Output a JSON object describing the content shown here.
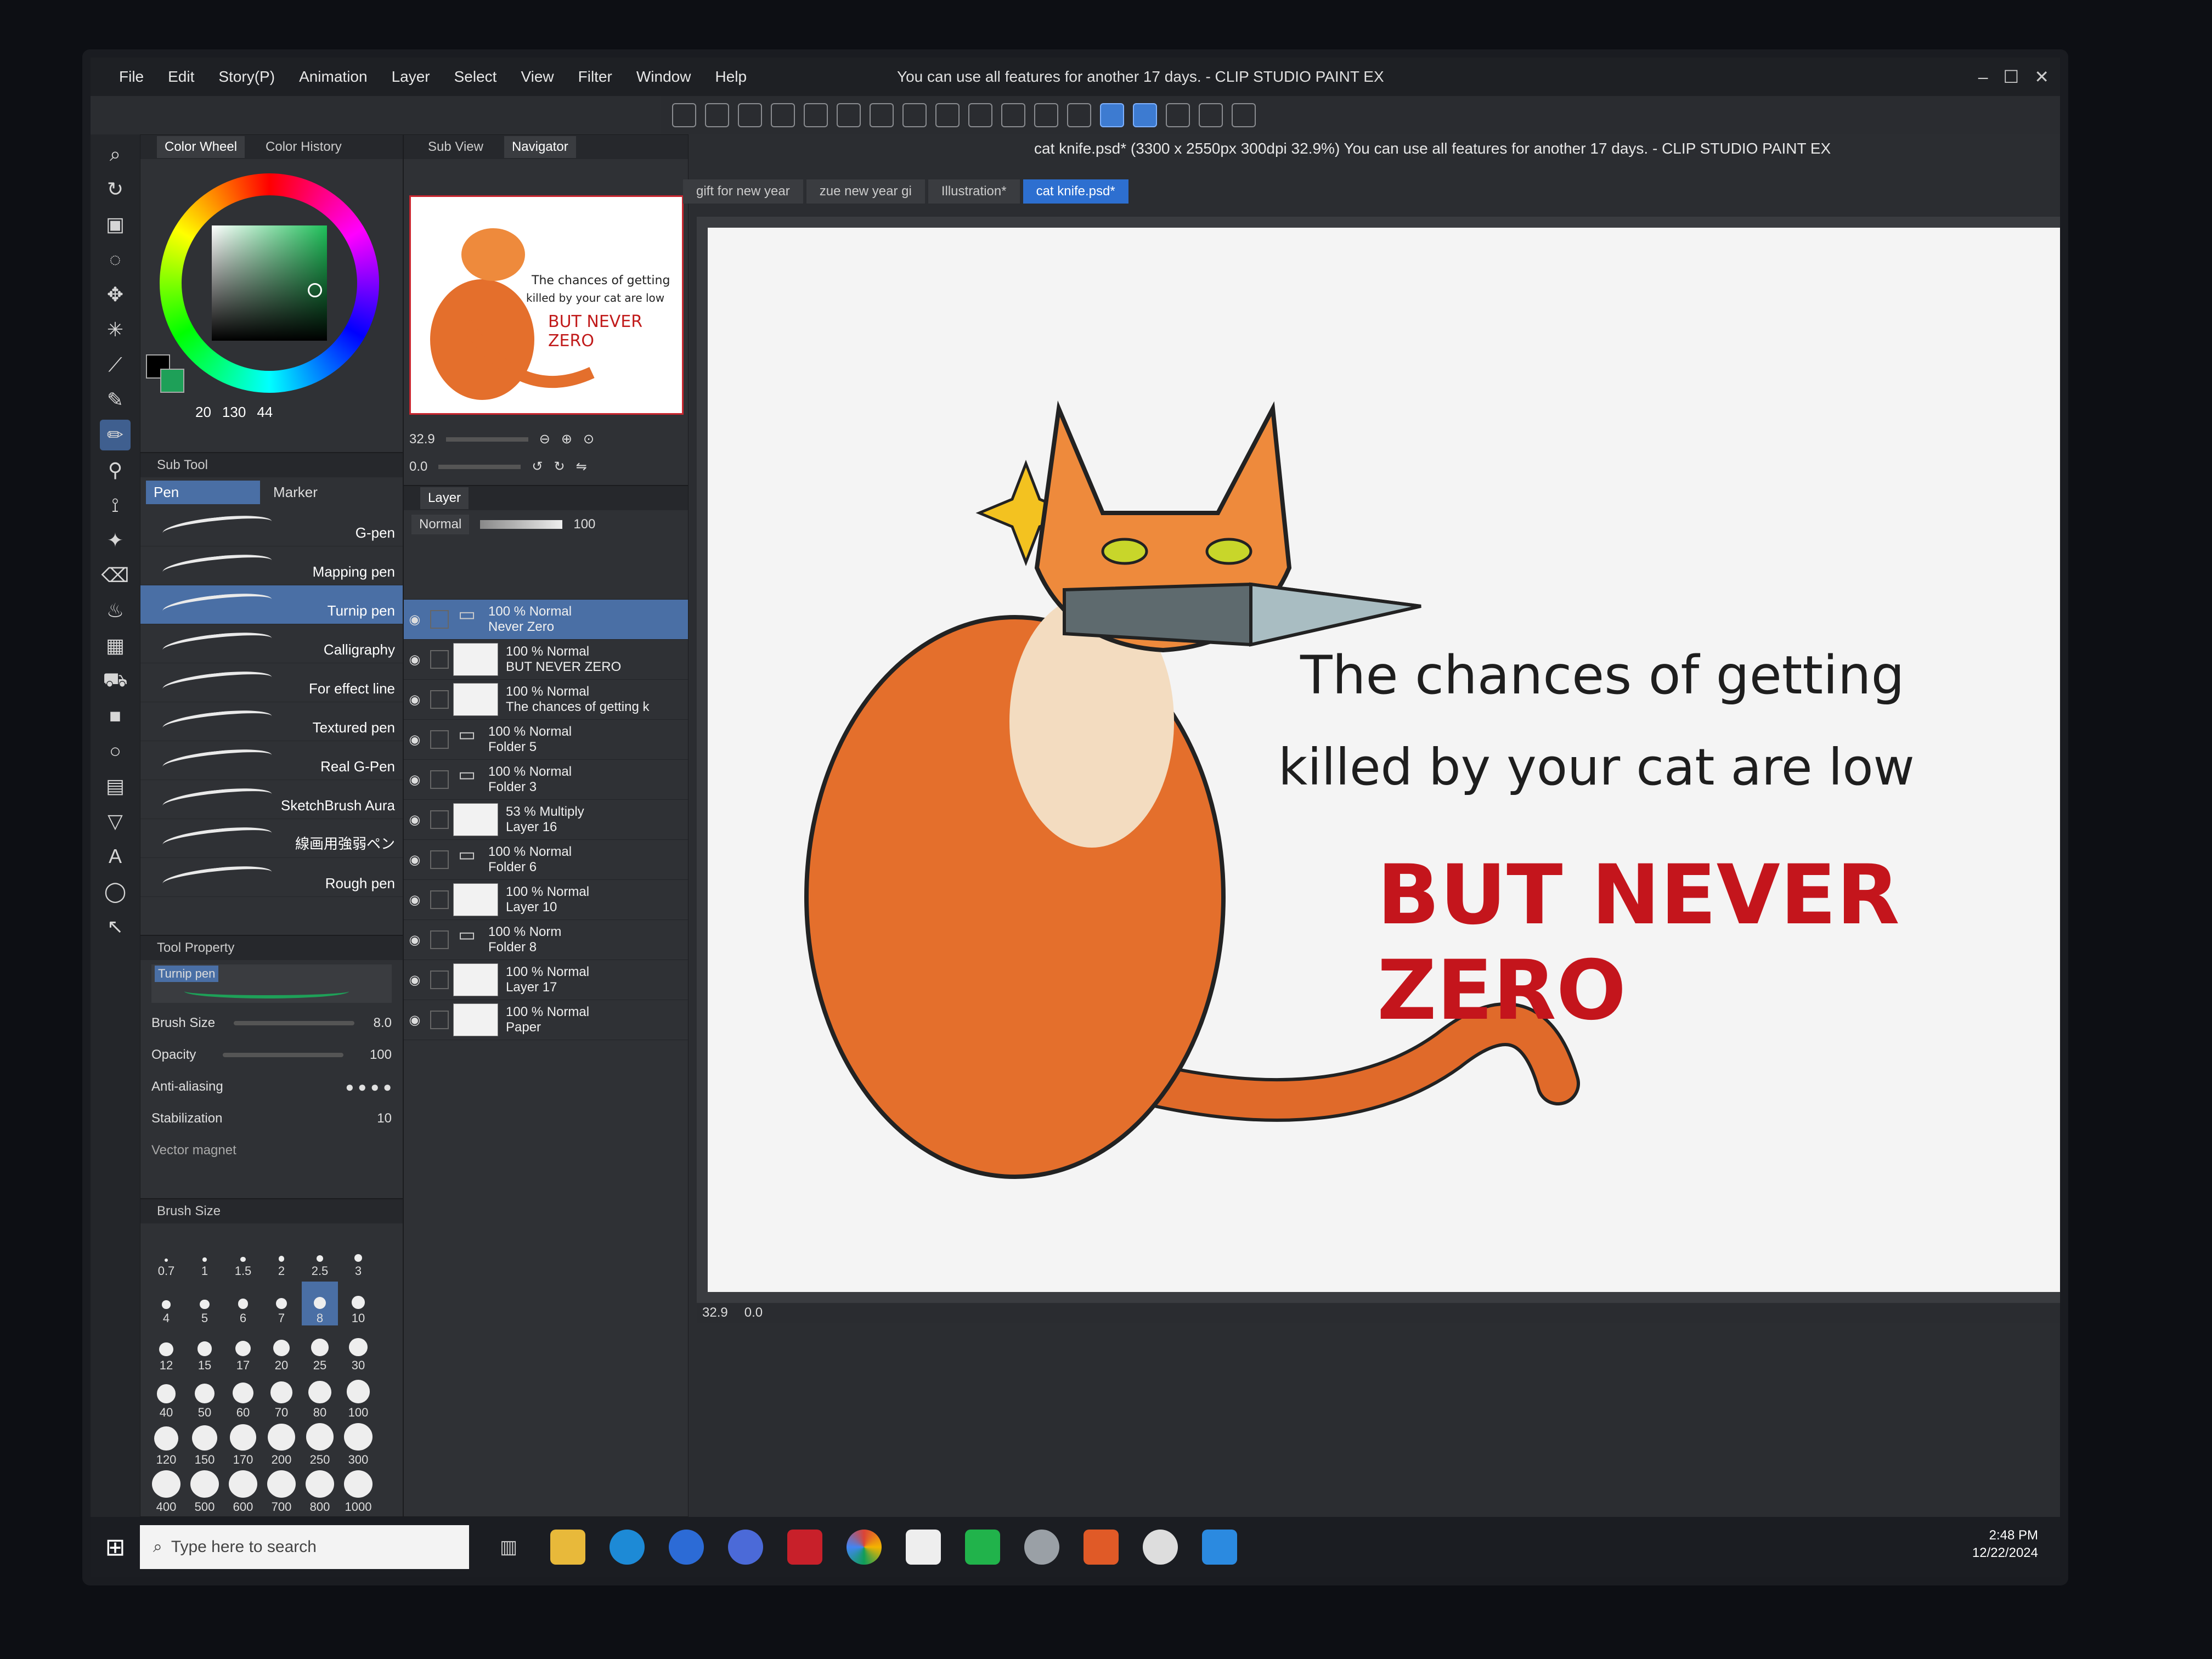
{
  "window": {
    "title": "You can use all features for another 17 days. - CLIP STUDIO PAINT EX",
    "menu": [
      "File",
      "Edit",
      "Story(P)",
      "Animation",
      "Layer",
      "Select",
      "View",
      "Filter",
      "Window",
      "Help"
    ]
  },
  "color_panel": {
    "tabs": [
      "Color Wheel",
      "Color History"
    ],
    "active_tab": "Color Wheel",
    "values": {
      "r": "20",
      "g": "130",
      "b": "44"
    },
    "current_color": "#1ea058"
  },
  "navigator": {
    "tabs": [
      "Sub View",
      "Navigator"
    ],
    "zoom": "32.9",
    "rotation": "0.0",
    "thumb_text": {
      "line1": "The chances of getting",
      "line2": "killed by your cat are low",
      "line3": "BUT NEVER ZERO"
    }
  },
  "subtool": {
    "panel_title": "Sub Tool",
    "groups": [
      "Pen",
      "Marker"
    ],
    "active_group": "Pen",
    "items": [
      "G-pen",
      "Mapping pen",
      "Turnip pen",
      "Calligraphy",
      "For effect line",
      "Textured pen",
      "Real G-Pen",
      "SketchBrush Aura",
      "線画用強弱ペン",
      "Rough pen"
    ],
    "active_item": "Turnip pen"
  },
  "tool_property": {
    "panel_title": "Tool Property",
    "tool_name": "Turnip pen",
    "brush_size_label": "Brush Size",
    "brush_size": "8.0",
    "opacity_label": "Opacity",
    "opacity": "100",
    "antialiasing_label": "Anti-aliasing",
    "stabilization_label": "Stabilization",
    "stabilization": "10",
    "vector_magnet_label": "Vector magnet"
  },
  "brush_size_panel": {
    "title": "Brush Size",
    "sizes": [
      "0.7",
      "1",
      "1.5",
      "2",
      "2.5",
      "3",
      "4",
      "5",
      "6",
      "7",
      "8",
      "10",
      "12",
      "15",
      "17",
      "20",
      "25",
      "30",
      "40",
      "50",
      "60",
      "70",
      "80",
      "100",
      "120",
      "150",
      "170",
      "200",
      "250",
      "300",
      "400",
      "500",
      "600",
      "700",
      "800",
      "1000"
    ],
    "active": "8"
  },
  "layer_panel": {
    "tab": "Layer",
    "blend_mode": "Normal",
    "opacity": "100",
    "layers": [
      {
        "meta": "100 % Normal",
        "name": "Never Zero",
        "type": "folder",
        "active": true
      },
      {
        "meta": "100 % Normal",
        "name": "BUT NEVER ZERO",
        "type": "layer"
      },
      {
        "meta": "100 % Normal",
        "name": "The chances of getting k",
        "type": "layer"
      },
      {
        "meta": "100 % Normal",
        "name": "Folder 5",
        "type": "folder"
      },
      {
        "meta": "100 % Normal",
        "name": "Folder 3",
        "type": "folder"
      },
      {
        "meta": "53 % Multiply",
        "name": "Layer 16",
        "type": "layer"
      },
      {
        "meta": "100 % Normal",
        "name": "Folder 6",
        "type": "folder"
      },
      {
        "meta": "100 % Normal",
        "name": "Layer 10",
        "type": "layer"
      },
      {
        "meta": "100 % Norm",
        "name": "Folder 8",
        "type": "folder"
      },
      {
        "meta": "100 % Normal",
        "name": "Layer 17",
        "type": "layer"
      },
      {
        "meta": "100 % Normal",
        "name": "Paper",
        "type": "layer"
      }
    ]
  },
  "document": {
    "title": "cat knife.psd* (3300 x 2550px 300dpi 32.9%)  You can use all features for another 17 days. - CLIP STUDIO PAINT EX",
    "tabs": [
      "gift for new year",
      "zue new year gi",
      "Illustration*",
      "cat knife.psd*"
    ],
    "active_tab": "cat knife.psd*",
    "caption_line1": "The chances of getting",
    "caption_line2": "killed by your cat are low",
    "caption_line3": "BUT NEVER ZERO",
    "status_zoom": "32.9",
    "status_rotation": "0.0"
  },
  "taskbar": {
    "search_placeholder": "Type here to search",
    "time": "2:48 PM",
    "date": "12/22/2024"
  }
}
